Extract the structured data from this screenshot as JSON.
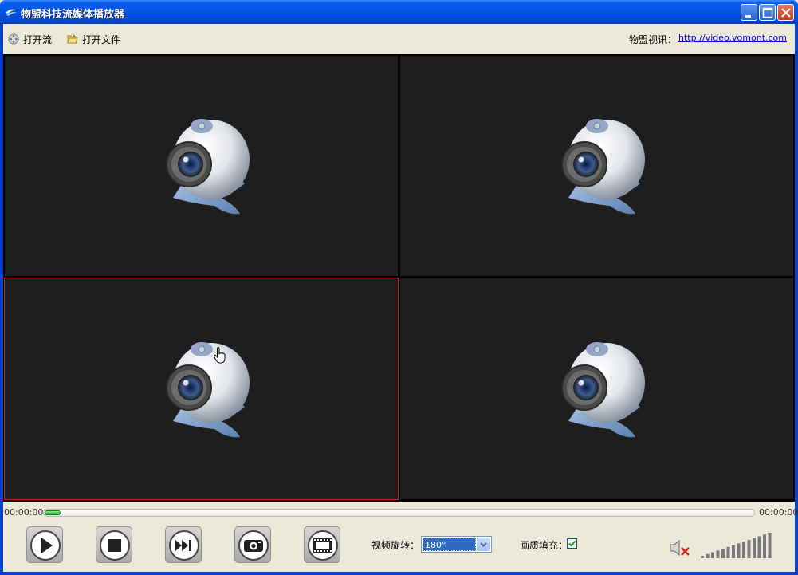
{
  "window": {
    "title": "物盟科技流媒体播放器"
  },
  "toolbar": {
    "open_stream": "打开流",
    "open_file": "打开文件",
    "info_label": "物盟视讯：",
    "info_link": "http://video.vomont.com"
  },
  "video_grid": {
    "cells": [
      {
        "id": "top-left",
        "active": false
      },
      {
        "id": "top-right",
        "active": false
      },
      {
        "id": "bottom-left",
        "active": true
      },
      {
        "id": "bottom-right",
        "active": false
      }
    ]
  },
  "playback": {
    "time_elapsed": "00:00:00",
    "time_total": "00:00:00",
    "progress": 0
  },
  "controls": {
    "buttons": [
      "play-icon",
      "stop-icon",
      "next-frame-icon",
      "snapshot-icon",
      "record-icon"
    ],
    "rotation_label": "视频旋转：",
    "rotation_value": "180°",
    "fill_label": "画质填充：",
    "fill_checked": true,
    "muted": true,
    "volume_bars": 14
  },
  "colors": {
    "titlebar": "#0054E3",
    "active_border": "#C81E1E",
    "cell_bg": "#1E1E1E",
    "selection": "#316AC5"
  }
}
